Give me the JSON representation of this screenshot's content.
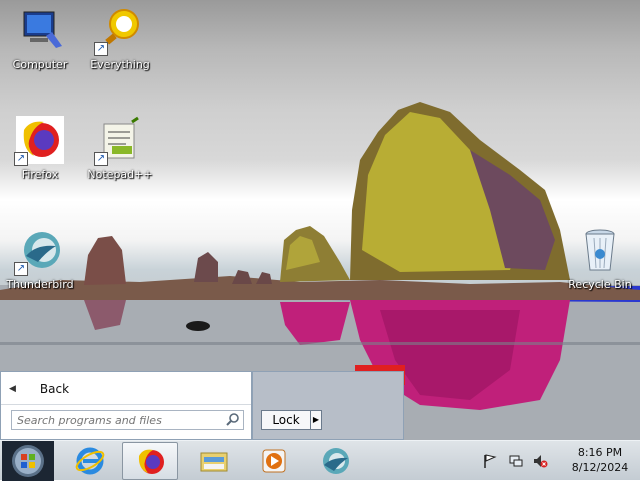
{
  "desktop": {
    "icons": [
      {
        "label": "Computer",
        "icon": "computer-icon"
      },
      {
        "label": "Everything",
        "icon": "everything-icon"
      },
      {
        "label": "Firefox",
        "icon": "firefox-icon"
      },
      {
        "label": "Notepad++",
        "icon": "notepad-plus-plus-icon"
      },
      {
        "label": "Thunderbird",
        "icon": "thunderbird-icon"
      },
      {
        "label": "Recycle Bin",
        "icon": "recycle-bin-icon"
      }
    ]
  },
  "start_menu": {
    "back_label": "Back",
    "search_placeholder": "Search programs and files",
    "lock_label": "Lock"
  },
  "taskbar": {
    "pinned": [
      {
        "icon": "internet-explorer-icon"
      },
      {
        "icon": "firefox-icon",
        "active": true
      },
      {
        "icon": "file-explorer-icon"
      },
      {
        "icon": "media-player-icon"
      },
      {
        "icon": "thunderbird-icon"
      }
    ],
    "tray_icons": [
      "action-center-flag-icon",
      "network-icon",
      "volume-muted-icon"
    ],
    "clock": {
      "time": "8:16 PM",
      "date": "8/12/2024"
    }
  },
  "colors": {
    "rock": "#a89a2a",
    "reflection": "#c0207a",
    "sea": "#1a2ad0",
    "taskbar": "#d0d6dc"
  }
}
